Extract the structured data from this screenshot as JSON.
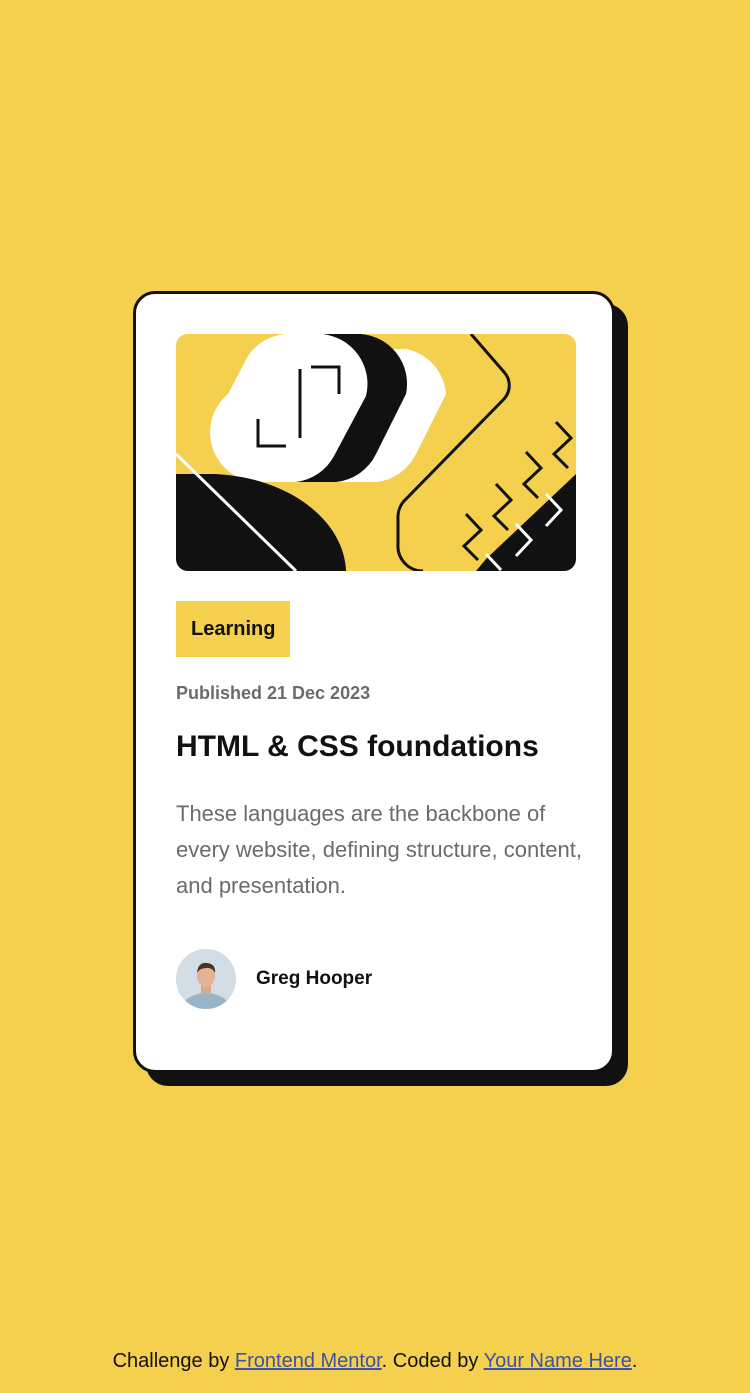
{
  "card": {
    "tag": "Learning",
    "published": "Published 21 Dec 2023",
    "title": "HTML & CSS foundations",
    "description": "These languages are the backbone of every website, defining structure, content, and presentation.",
    "author": {
      "name": "Greg Hooper"
    }
  },
  "footer": {
    "prefix": "Challenge by ",
    "mentor_link": "Frontend Mentor",
    "middle": ". Coded by ",
    "name_link": "Your Name Here",
    "suffix": "."
  },
  "colors": {
    "background": "#f4d04e",
    "card": "#ffffff",
    "ink": "#111111",
    "muted": "#6b6b6b",
    "link": "#3e52a3"
  }
}
